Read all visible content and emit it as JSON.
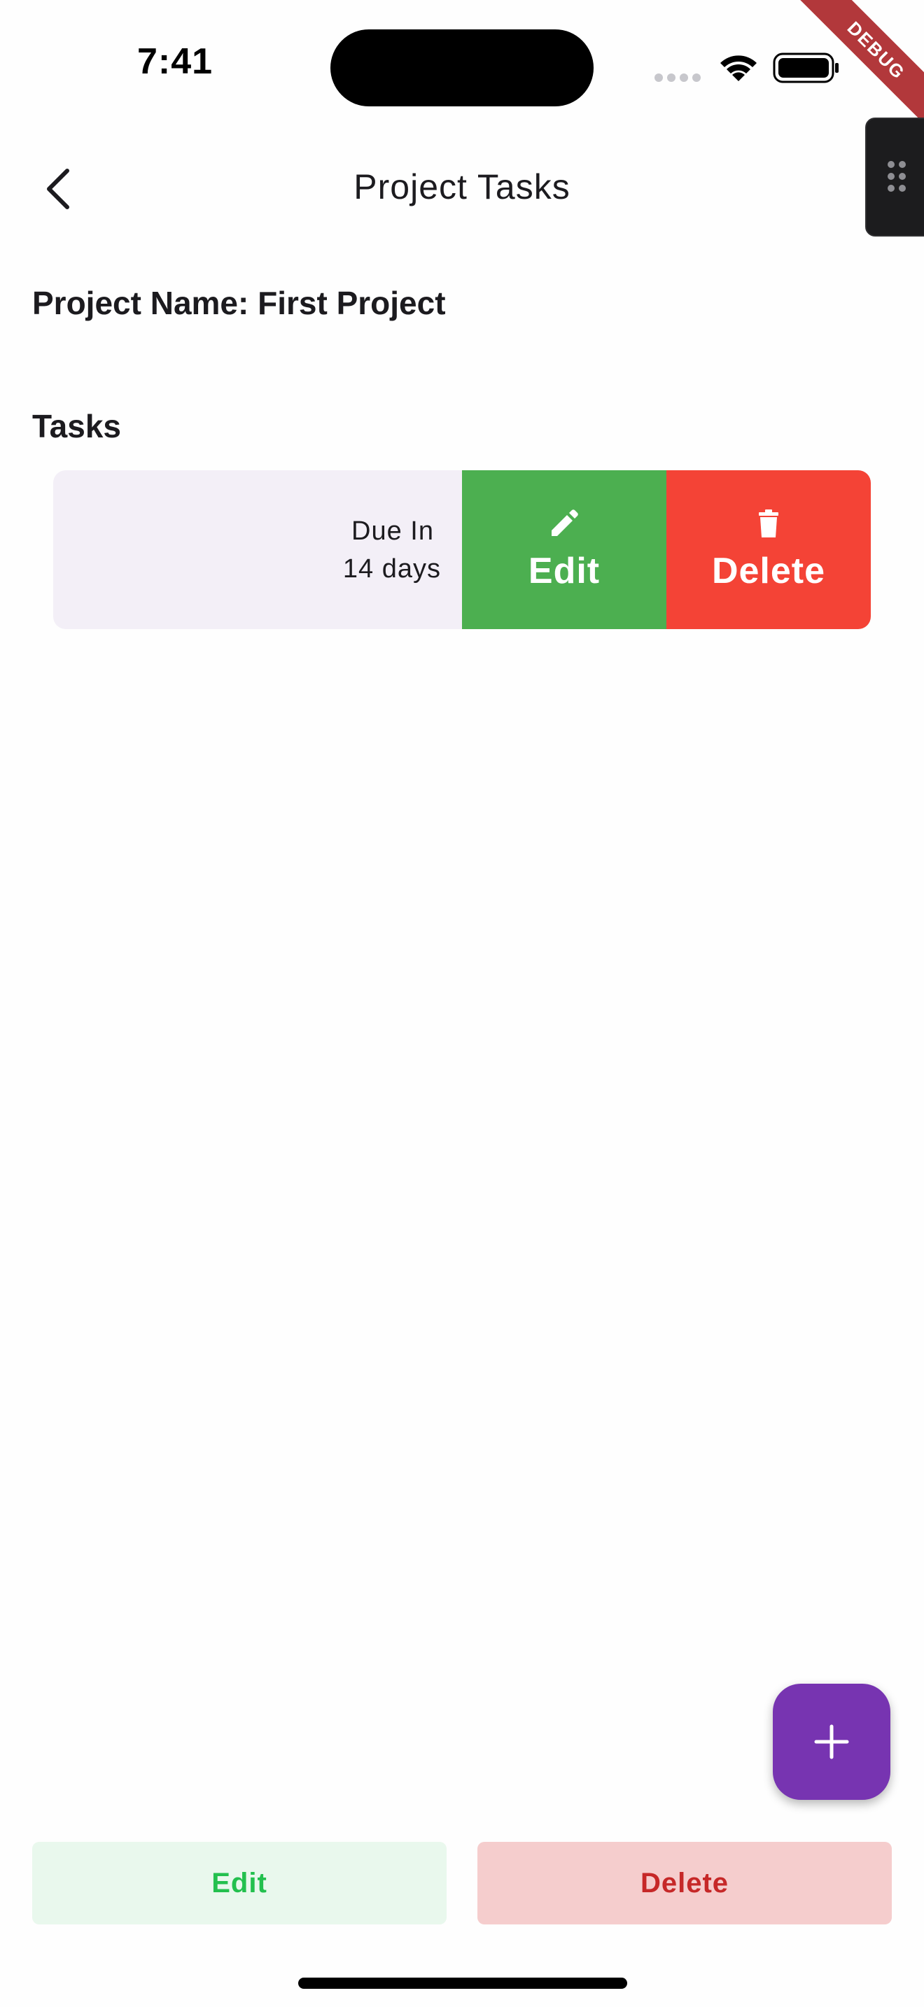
{
  "status_bar": {
    "time": "7:41",
    "icons": [
      "signal-dots-icon",
      "wifi-icon",
      "battery-icon"
    ]
  },
  "debug_banner": "DEBUG",
  "app_bar": {
    "back_icon": "chevron-left-icon",
    "title": "Project Tasks"
  },
  "project": {
    "name_label": "Project Name: First Project"
  },
  "tasks": {
    "heading": "Tasks",
    "items": [
      {
        "due_line_1": "Due In",
        "due_line_2": "14 days",
        "actions": [
          {
            "label": "Edit",
            "icon": "pencil-icon",
            "color": "#4caf50"
          },
          {
            "label": "Delete",
            "icon": "trash-icon",
            "color": "#f44336"
          }
        ]
      }
    ]
  },
  "fab": {
    "icon": "plus-icon",
    "color": "#7734b1"
  },
  "bottom_actions": {
    "edit_label": "Edit",
    "delete_label": "Delete"
  },
  "colors": {
    "card_background": "#f3eff7",
    "edit_button_bg": "#e9f8ed",
    "edit_button_text": "#23c04e",
    "delete_button_bg": "#f5cdcd",
    "delete_button_text": "#c62828"
  }
}
